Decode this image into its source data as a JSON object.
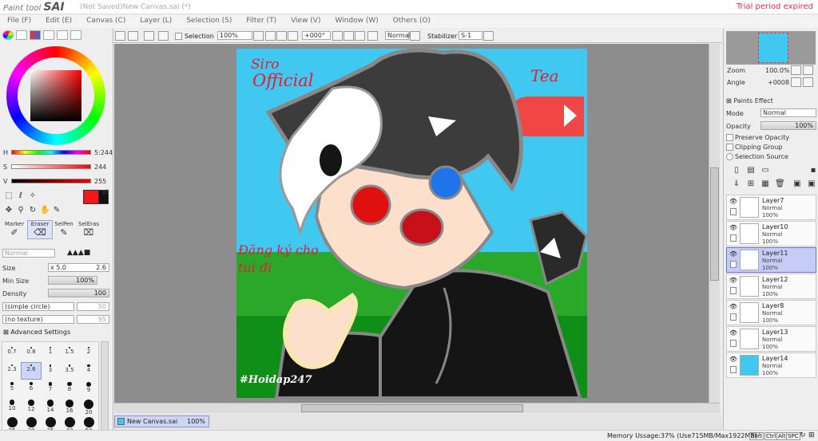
{
  "app": {
    "logo_small": "Paint tool",
    "logo_big": "SAI",
    "window_title": "(Not Saved)New Canvas.sai (*)",
    "trial": "Trial period expired"
  },
  "menu": [
    "File (F)",
    "Edit (E)",
    "Canvas (C)",
    "Layer (L)",
    "Selection (S)",
    "Filter (T)",
    "View (V)",
    "Window (W)",
    "Others (O)"
  ],
  "color": {
    "h_label": "H",
    "s_label": "S",
    "v_label": "V",
    "h_value": "5:244",
    "s_value": "244",
    "v_value": "255",
    "primary": "#f01818",
    "secondary": "#111111"
  },
  "tools": [
    {
      "label": "Marker",
      "selected": false
    },
    {
      "label": "Eraser",
      "selected": true
    },
    {
      "label": "SelPen",
      "selected": false
    },
    {
      "label": "SelEras",
      "selected": false
    }
  ],
  "tool_props": {
    "blend": "Normal",
    "size_label": "Size",
    "size_mult": "x 5.0",
    "size_value": "2.6",
    "min_size_label": "Min Size",
    "min_size_value": "100%",
    "density_label": "Density",
    "density_value": "100",
    "shape": "(simple circle)",
    "shape_value": "50",
    "texture": "(no texture)",
    "texture_value": "95",
    "advanced": "Advanced Settings"
  },
  "brush_sizes": [
    "0.7",
    "0.8",
    "1",
    "1.5",
    "2",
    "2.3",
    "2.6",
    "3",
    "3.5",
    "4",
    "5",
    "6",
    "7",
    "8",
    "9",
    "10",
    "12",
    "14",
    "16",
    "20",
    "25",
    "30",
    "35",
    "40",
    "50"
  ],
  "brush_selected": "2.6",
  "toolbar": {
    "selection_label": "Selection",
    "zoom": "100%",
    "angle": "+000°",
    "mode": "Normal",
    "stabilizer_label": "Stabilizer",
    "stabilizer": "S-1"
  },
  "canvas_text": {
    "line1": "Siro",
    "line2": "Official",
    "signature": "Tea",
    "red_text": "Đăng ký cho tui đi",
    "tag": "#Hoidap247"
  },
  "document_tab": {
    "name": "New Canvas.sai",
    "zoom": "100%"
  },
  "navigator": {
    "zoom_label": "Zoom",
    "zoom": "100.0%",
    "angle_label": "Angle",
    "angle": "+0008"
  },
  "layer_panel": {
    "effect": "Paints Effect",
    "mode_label": "Mode",
    "mode": "Normal",
    "opacity_label": "Opacity",
    "opacity": "100%",
    "preserve": "Preserve Opacity",
    "clipping": "Clipping Group",
    "selsource": "Selection Source"
  },
  "layers": [
    {
      "name": "Layer7",
      "mode": "Normal",
      "opacity": "100%",
      "selected": false
    },
    {
      "name": "Layer10",
      "mode": "Normal",
      "opacity": "100%",
      "selected": false
    },
    {
      "name": "Layer11",
      "mode": "Normal",
      "opacity": "100%",
      "selected": true
    },
    {
      "name": "Layer12",
      "mode": "Normal",
      "opacity": "100%",
      "selected": false
    },
    {
      "name": "Layer8",
      "mode": "Normal",
      "opacity": "100%",
      "selected": false
    },
    {
      "name": "Layer13",
      "mode": "Normal",
      "opacity": "100%",
      "selected": false
    },
    {
      "name": "Layer14",
      "mode": "Normal",
      "opacity": "100%",
      "selected": false
    }
  ],
  "status": {
    "memory": "Memory Ussage:37% (Use715MB/Max1922MB)",
    "keys": [
      "Shft",
      "Ctrl",
      "Alt",
      "SPC"
    ]
  }
}
